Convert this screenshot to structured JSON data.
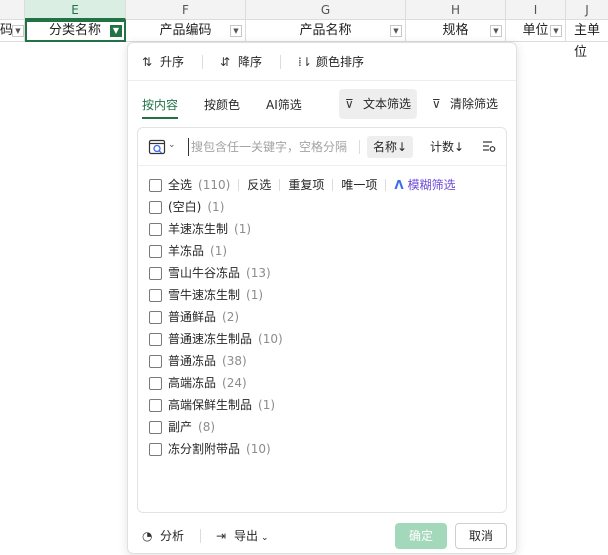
{
  "columns": {
    "letters": [
      "",
      "E",
      "F",
      "G",
      "H",
      "I",
      "J"
    ],
    "headers": [
      "码",
      "分类名称",
      "产品编码",
      "产品名称",
      "规格",
      "单位",
      "主单位"
    ]
  },
  "sort": {
    "ascending": "升序",
    "descending": "降序",
    "color_sort": "颜色排序"
  },
  "tabs": {
    "by_content": "按内容",
    "by_color": "按颜色",
    "ai_filter": "AI筛选",
    "text_filter": "文本筛选",
    "clear_filter": "清除筛选"
  },
  "search": {
    "placeholder": "搜包含任一关键字，空格分隔",
    "name_sort": "名称↓",
    "count_sort": "计数↓"
  },
  "list": {
    "select_all": "全选",
    "select_all_count": "(110)",
    "invert": "反选",
    "duplicates": "重复项",
    "unique": "唯一项",
    "fuzzy": "模糊筛选",
    "items": [
      {
        "label": "(空白)",
        "count": "(1)"
      },
      {
        "label": "羊速冻生制",
        "count": "(1)"
      },
      {
        "label": "羊冻品",
        "count": "(1)"
      },
      {
        "label": "雪山牛谷冻品",
        "count": "(13)"
      },
      {
        "label": "雪牛速冻生制",
        "count": "(1)"
      },
      {
        "label": "普通鲜品",
        "count": "(2)"
      },
      {
        "label": "普通速冻生制品",
        "count": "(10)"
      },
      {
        "label": "普通冻品",
        "count": "(38)"
      },
      {
        "label": "高端冻品",
        "count": "(24)"
      },
      {
        "label": "高端保鲜生制品",
        "count": "(1)"
      },
      {
        "label": "副产",
        "count": "(8)"
      },
      {
        "label": "冻分割附带品",
        "count": "(10)"
      }
    ]
  },
  "footer": {
    "analyze": "分析",
    "export": "导出",
    "ok": "确定",
    "cancel": "取消"
  },
  "colors": {
    "accent": "#217346",
    "ok_disabled": "#a4d8bb",
    "fuzzy": "#6b49d8"
  }
}
